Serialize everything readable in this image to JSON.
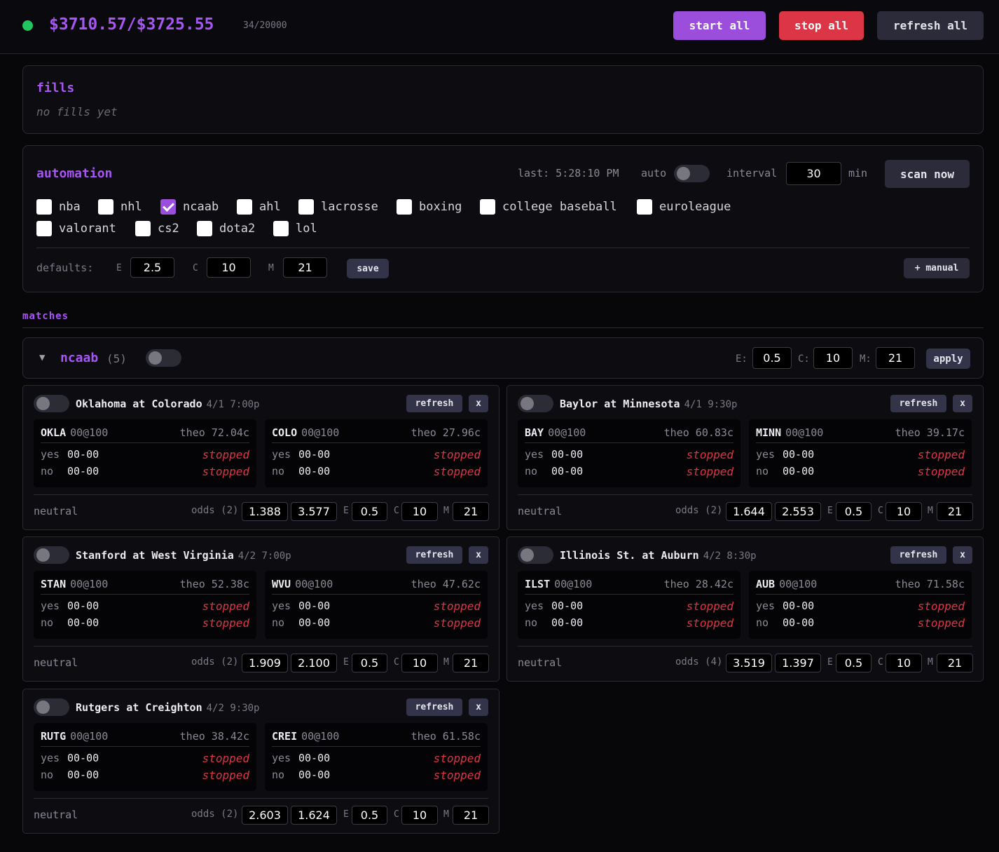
{
  "header": {
    "balance": "$3710.57/$3725.55",
    "counter": "34/20000",
    "start_label": "start all",
    "stop_label": "stop all",
    "refresh_label": "refresh all"
  },
  "fills": {
    "title": "fills",
    "empty": "no fills yet"
  },
  "automation": {
    "title": "automation",
    "last": "last: 5:28:10 PM",
    "auto_label": "auto",
    "interval_label": "interval",
    "interval_value": "30",
    "min_label": "min",
    "scan_label": "scan now",
    "sports": [
      {
        "label": "nba",
        "checked": false
      },
      {
        "label": "nhl",
        "checked": false
      },
      {
        "label": "ncaab",
        "checked": true
      },
      {
        "label": "ahl",
        "checked": false
      },
      {
        "label": "lacrosse",
        "checked": false
      },
      {
        "label": "boxing",
        "checked": false
      },
      {
        "label": "college baseball",
        "checked": false
      },
      {
        "label": "euroleague",
        "checked": false
      },
      {
        "label": "valorant",
        "checked": false
      },
      {
        "label": "cs2",
        "checked": false
      },
      {
        "label": "dota2",
        "checked": false
      },
      {
        "label": "lol",
        "checked": false
      }
    ],
    "defaults_label": "defaults:",
    "e_label": "E",
    "e_value": "2.5",
    "c_label": "C",
    "c_value": "10",
    "m_label": "M",
    "m_value": "21",
    "save_label": "save",
    "manual_label": "+ manual"
  },
  "matches_title": "matches",
  "group": {
    "caret": "▼",
    "name": "ncaab",
    "count": "(5)",
    "e_label": "E:",
    "e_value": "0.5",
    "c_label": "C:",
    "c_value": "10",
    "m_label": "M:",
    "m_value": "21",
    "apply_label": "apply"
  },
  "card_common": {
    "refresh_label": "refresh",
    "close_label": "x",
    "yes_label": "yes",
    "no_label": "no",
    "neutral_label": "neutral",
    "e_label": "E",
    "c_label": "C",
    "m_label": "M"
  },
  "cards": [
    {
      "title": "Oklahoma at Colorado",
      "date": "4/1 7:00p",
      "odds_label": "odds (2)",
      "odds1": "1.388",
      "odds2": "3.577",
      "e": "0.5",
      "c": "10",
      "m": "21",
      "sides": [
        {
          "code": "OKLA",
          "quote": "00@100",
          "theo": "theo 72.04c",
          "yes": "00-00",
          "no": "00-00",
          "yes_status": "stopped",
          "no_status": "stopped"
        },
        {
          "code": "COLO",
          "quote": "00@100",
          "theo": "theo 27.96c",
          "yes": "00-00",
          "no": "00-00",
          "yes_status": "stopped",
          "no_status": "stopped"
        }
      ]
    },
    {
      "title": "Baylor at Minnesota",
      "date": "4/1 9:30p",
      "odds_label": "odds (2)",
      "odds1": "1.644",
      "odds2": "2.553",
      "e": "0.5",
      "c": "10",
      "m": "21",
      "sides": [
        {
          "code": "BAY",
          "quote": "00@100",
          "theo": "theo 60.83c",
          "yes": "00-00",
          "no": "00-00",
          "yes_status": "stopped",
          "no_status": "stopped"
        },
        {
          "code": "MINN",
          "quote": "00@100",
          "theo": "theo 39.17c",
          "yes": "00-00",
          "no": "00-00",
          "yes_status": "stopped",
          "no_status": "stopped"
        }
      ]
    },
    {
      "title": "Stanford at West Virginia",
      "date": "4/2 7:00p",
      "odds_label": "odds (2)",
      "odds1": "1.909",
      "odds2": "2.100",
      "e": "0.5",
      "c": "10",
      "m": "21",
      "sides": [
        {
          "code": "STAN",
          "quote": "00@100",
          "theo": "theo 52.38c",
          "yes": "00-00",
          "no": "00-00",
          "yes_status": "stopped",
          "no_status": "stopped"
        },
        {
          "code": "WVU",
          "quote": "00@100",
          "theo": "theo 47.62c",
          "yes": "00-00",
          "no": "00-00",
          "yes_status": "stopped",
          "no_status": "stopped"
        }
      ]
    },
    {
      "title": "Illinois St. at Auburn",
      "date": "4/2 8:30p",
      "odds_label": "odds (4)",
      "odds1": "3.519",
      "odds2": "1.397",
      "e": "0.5",
      "c": "10",
      "m": "21",
      "sides": [
        {
          "code": "ILST",
          "quote": "00@100",
          "theo": "theo 28.42c",
          "yes": "00-00",
          "no": "00-00",
          "yes_status": "stopped",
          "no_status": "stopped"
        },
        {
          "code": "AUB",
          "quote": "00@100",
          "theo": "theo 71.58c",
          "yes": "00-00",
          "no": "00-00",
          "yes_status": "stopped",
          "no_status": "stopped"
        }
      ]
    },
    {
      "title": "Rutgers at Creighton",
      "date": "4/2 9:30p",
      "odds_label": "odds (2)",
      "odds1": "2.603",
      "odds2": "1.624",
      "e": "0.5",
      "c": "10",
      "m": "21",
      "sides": [
        {
          "code": "RUTG",
          "quote": "00@100",
          "theo": "theo 38.42c",
          "yes": "00-00",
          "no": "00-00",
          "yes_status": "stopped",
          "no_status": "stopped"
        },
        {
          "code": "CREI",
          "quote": "00@100",
          "theo": "theo 61.58c",
          "yes": "00-00",
          "no": "00-00",
          "yes_status": "stopped",
          "no_status": "stopped"
        }
      ]
    }
  ]
}
